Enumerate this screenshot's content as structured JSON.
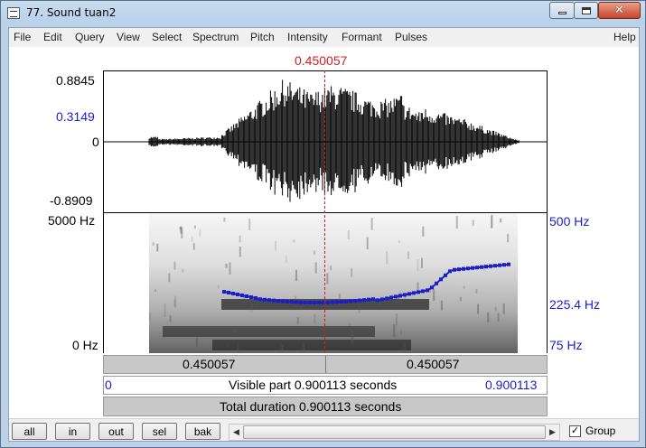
{
  "window": {
    "title": "77. Sound tuan2",
    "minimize_icon": "minimize-icon",
    "maximize_icon": "maximize-icon",
    "close_icon": "close-icon"
  },
  "menu": {
    "left": [
      "File",
      "Edit",
      "Query",
      "View",
      "Select",
      "Spectrum",
      "Pitch",
      "Intensity",
      "Formant",
      "Pulses"
    ],
    "right": "Help"
  },
  "cursor": {
    "time_label": "0.450057"
  },
  "waveform": {
    "y_max": "0.8845",
    "y_marker": "0.3149",
    "y_zero": "0",
    "y_min": "-0.8909"
  },
  "spectrogram": {
    "freq_top": "5000 Hz",
    "freq_bottom": "0 Hz"
  },
  "pitch": {
    "top": "500 Hz",
    "cursor_value": "225.4 Hz",
    "bottom": "75 Hz"
  },
  "bars": {
    "left_segment": "0.450057",
    "right_segment": "0.450057",
    "visible_start": "0",
    "visible_label": "Visible part 0.900113 seconds",
    "visible_end": "0.900113",
    "total_label": "Total duration 0.900113 seconds"
  },
  "bottom": {
    "buttons": [
      "all",
      "in",
      "out",
      "sel",
      "bak"
    ],
    "group_label": "Group",
    "group_checked": "✓"
  },
  "colors": {
    "cursor": "#d21e1e",
    "pitch": "#1c1cc8",
    "waveform": "#000000"
  }
}
